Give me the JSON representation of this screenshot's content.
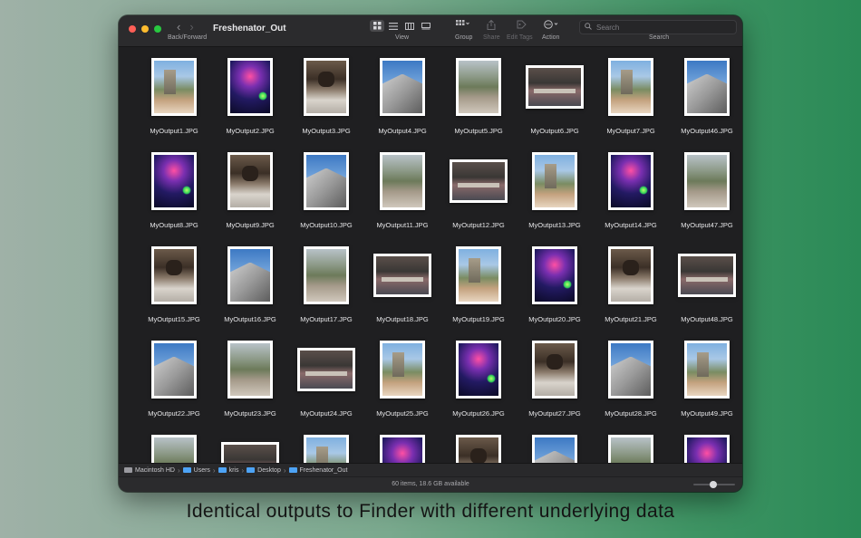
{
  "window": {
    "title": "Freshenator_Out",
    "nav_label": "Back/Forward",
    "nav_back_glyph": "‹",
    "nav_forward_glyph": "›"
  },
  "toolbar": {
    "view_label": "View",
    "group_label": "Group",
    "share_label": "Share",
    "edit_tags_label": "Edit Tags",
    "action_label": "Action",
    "search_label": "Search",
    "search_placeholder": "Search"
  },
  "files": [
    {
      "name": "MyOutput1.JPG",
      "art": "city",
      "orient": "p"
    },
    {
      "name": "MyOutput2.JPG",
      "art": "concert",
      "orient": "p"
    },
    {
      "name": "MyOutput3.JPG",
      "art": "dog",
      "orient": "p"
    },
    {
      "name": "MyOutput4.JPG",
      "art": "tri",
      "orient": "p"
    },
    {
      "name": "MyOutput5.JPG",
      "art": "rocks",
      "orient": "p"
    },
    {
      "name": "MyOutput6.JPG",
      "art": "office",
      "orient": "l"
    },
    {
      "name": "MyOutput7.JPG",
      "art": "city",
      "orient": "p"
    },
    {
      "name": "MyOutput46.JPG",
      "art": "tri",
      "orient": "p"
    },
    {
      "name": "MyOutput8.JPG",
      "art": "concert",
      "orient": "p"
    },
    {
      "name": "MyOutput9.JPG",
      "art": "dog",
      "orient": "p"
    },
    {
      "name": "MyOutput10.JPG",
      "art": "tri",
      "orient": "p"
    },
    {
      "name": "MyOutput11.JPG",
      "art": "rocks",
      "orient": "p"
    },
    {
      "name": "MyOutput12.JPG",
      "art": "office",
      "orient": "l"
    },
    {
      "name": "MyOutput13.JPG",
      "art": "city",
      "orient": "p"
    },
    {
      "name": "MyOutput14.JPG",
      "art": "concert",
      "orient": "p"
    },
    {
      "name": "MyOutput47.JPG",
      "art": "rocks",
      "orient": "p"
    },
    {
      "name": "MyOutput15.JPG",
      "art": "dog",
      "orient": "p"
    },
    {
      "name": "MyOutput16.JPG",
      "art": "tri",
      "orient": "p"
    },
    {
      "name": "MyOutput17.JPG",
      "art": "rocks",
      "orient": "p"
    },
    {
      "name": "MyOutput18.JPG",
      "art": "office",
      "orient": "l"
    },
    {
      "name": "MyOutput19.JPG",
      "art": "city",
      "orient": "p"
    },
    {
      "name": "MyOutput20.JPG",
      "art": "concert",
      "orient": "p"
    },
    {
      "name": "MyOutput21.JPG",
      "art": "dog",
      "orient": "p"
    },
    {
      "name": "MyOutput48.JPG",
      "art": "office",
      "orient": "l"
    },
    {
      "name": "MyOutput22.JPG",
      "art": "tri",
      "orient": "p"
    },
    {
      "name": "MyOutput23.JPG",
      "art": "rocks",
      "orient": "p"
    },
    {
      "name": "MyOutput24.JPG",
      "art": "office",
      "orient": "l"
    },
    {
      "name": "MyOutput25.JPG",
      "art": "city",
      "orient": "p"
    },
    {
      "name": "MyOutput26.JPG",
      "art": "concert",
      "orient": "p"
    },
    {
      "name": "MyOutput27.JPG",
      "art": "dog",
      "orient": "p"
    },
    {
      "name": "MyOutput28.JPG",
      "art": "tri",
      "orient": "p"
    },
    {
      "name": "MyOutput49.JPG",
      "art": "city",
      "orient": "p"
    },
    {
      "name": "",
      "art": "rocks",
      "orient": "p"
    },
    {
      "name": "",
      "art": "office",
      "orient": "l"
    },
    {
      "name": "",
      "art": "city",
      "orient": "p"
    },
    {
      "name": "",
      "art": "concert",
      "orient": "p"
    },
    {
      "name": "",
      "art": "dog",
      "orient": "p"
    },
    {
      "name": "",
      "art": "tri",
      "orient": "p"
    },
    {
      "name": "",
      "art": "rocks",
      "orient": "p"
    },
    {
      "name": "",
      "art": "concert",
      "orient": "p"
    }
  ],
  "pathbar": {
    "items": [
      "Macintosh HD",
      "Users",
      "kris",
      "Desktop",
      "Freshenator_Out"
    ],
    "separator": "›"
  },
  "status": {
    "text": "60 items, 18.6 GB available"
  },
  "caption": "Identical outputs to Finder with different underlying data",
  "icons": {
    "view_icon": "icon-grid",
    "group_icon": "grid-dropdown",
    "share_icon": "share",
    "tag_icon": "tag",
    "action_icon": "ellipsis-circle",
    "search_icon": "magnifier"
  }
}
